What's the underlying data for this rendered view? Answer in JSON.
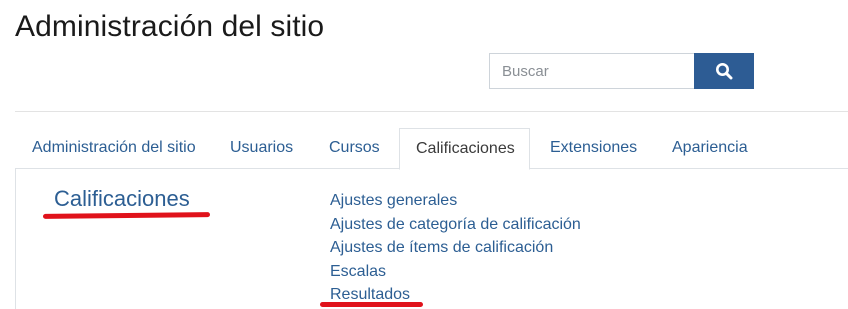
{
  "page": {
    "title": "Administración del sitio"
  },
  "search": {
    "placeholder": "Buscar",
    "value": "",
    "button_icon": "search-icon"
  },
  "tabs": [
    {
      "label": "Administración del sitio",
      "active": false
    },
    {
      "label": "Usuarios",
      "active": false
    },
    {
      "label": "Cursos",
      "active": false
    },
    {
      "label": "Calificaciones",
      "active": true
    },
    {
      "label": "Extensiones",
      "active": false
    },
    {
      "label": "Apariencia",
      "active": false
    }
  ],
  "section": {
    "heading": "Calificaciones",
    "links": [
      {
        "label": "Ajustes generales"
      },
      {
        "label": "Ajustes de categoría de calificación"
      },
      {
        "label": "Ajustes de ítems de calificación"
      },
      {
        "label": "Escalas"
      },
      {
        "label": "Resultados"
      }
    ]
  },
  "colors": {
    "link": "#2c5e93",
    "button": "#2d5c94",
    "highlight_mark": "#e0121b"
  }
}
